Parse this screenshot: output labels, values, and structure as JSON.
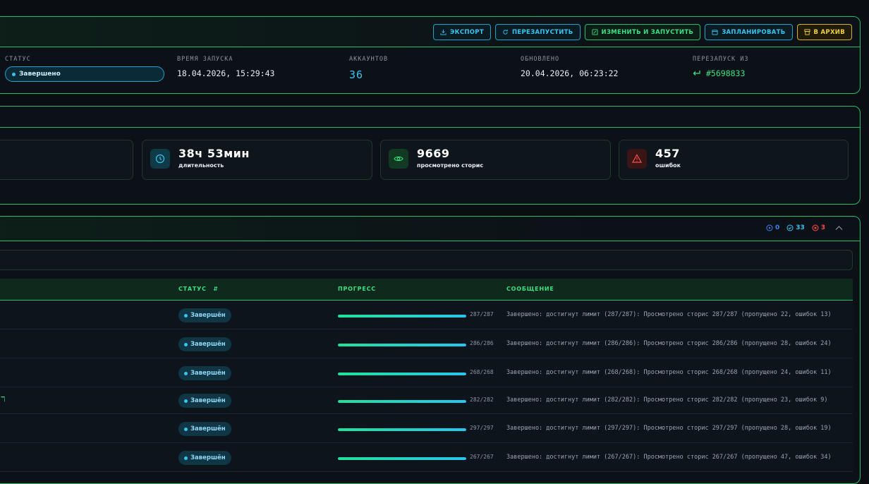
{
  "toolbar": {
    "export": "экспорт",
    "restart": "перезапустить",
    "edit_run": "изменить и запустить",
    "schedule": "запланировать",
    "archive": "в архив"
  },
  "run_meta": {
    "status_label": "статус",
    "status_value": "Завершено",
    "start_label": "время запуска",
    "start_value": "18.04.2026, 15:29:43",
    "accounts_label": "аккаунтов",
    "accounts_value": "36",
    "updated_label": "обновлено",
    "updated_value": "20.04.2026, 06:23:22",
    "restart_from_label": "перезапуск из",
    "restart_from_value": "#5698833"
  },
  "stats": [
    {
      "value": "38ч 53мин",
      "label": "длительность",
      "icon": "clock-icon"
    },
    {
      "value": "9669",
      "label": "просмотрено сторис",
      "icon": "eye-icon"
    },
    {
      "value": "457",
      "label": "ошибок",
      "icon": "warning-icon"
    }
  ],
  "counters": {
    "running": "0",
    "done": "33",
    "failed": "3"
  },
  "table": {
    "headers": {
      "status": "статус",
      "progress": "прогресс",
      "message": "сообщение"
    },
    "rows": [
      {
        "status": "Завершён",
        "progress": 1.0,
        "count": "287/287",
        "message": "Завершено: достигнут лимит (287/287): Просмотрено сторис 287/287 (пропущено 22, ошибок 13)"
      },
      {
        "status": "Завершён",
        "progress": 1.0,
        "count": "286/286",
        "message": "Завершено: достигнут лимит (286/286): Просмотрено сторис 286/286 (пропущено 28, ошибок 24)"
      },
      {
        "status": "Завершён",
        "progress": 1.0,
        "count": "268/268",
        "message": "Завершено: достигнут лимит (268/268): Просмотрено сторис 268/268 (пропущено 24, ошибок 11)"
      },
      {
        "status": "Завершён",
        "progress": 1.0,
        "count": "282/282",
        "message": "Завершено: достигнут лимит (282/282): Просмотрено сторис 282/282 (пропущено 23, ошибок 9)"
      },
      {
        "status": "Завершён",
        "progress": 1.0,
        "count": "297/297",
        "message": "Завершено: достигнут лимит (297/297): Просмотрено сторис 297/297 (пропущено 28, ошибок 19)"
      },
      {
        "status": "Завершён",
        "progress": 1.0,
        "count": "267/267",
        "message": "Завершено: достигнут лимит (267/267): Просмотрено сторис 267/267 (пропущено 47, ошибок 34)"
      }
    ]
  },
  "colors": {
    "accent_green": "#3be083",
    "accent_cyan": "#35c6f0",
    "accent_yellow": "#f1d13a",
    "error_red": "#ff4d4d"
  }
}
